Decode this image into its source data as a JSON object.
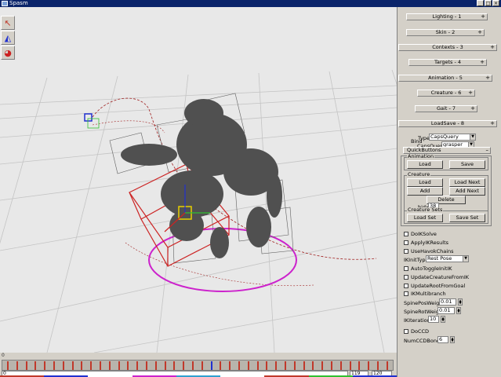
{
  "window": {
    "title": "Spasm",
    "buttons": [
      "_",
      "□",
      "×"
    ]
  },
  "toolbar": {
    "tools": [
      {
        "icon": "select-arrow-icon",
        "glyph": "↖"
      },
      {
        "icon": "ik-effector-icon",
        "glyph": "◭"
      },
      {
        "icon": "physics-icon",
        "glyph": "◕"
      }
    ]
  },
  "rollouts": [
    {
      "label": "Lighting - 1"
    },
    {
      "label": "Skin - 2"
    },
    {
      "label": "Contexts - 3"
    },
    {
      "label": "Targets - 4"
    },
    {
      "label": "Animation - 5"
    },
    {
      "label": "Creature - 6"
    },
    {
      "label": "Gait - 7"
    },
    {
      "label": "LoadSave - 8"
    }
  ],
  "loadsave": {
    "type_label": "Type",
    "type_value": "CapsQuery",
    "caps_label": "CapsQuery",
    "caps_value": "grasper",
    "bind_label": "Bind",
    "quickbuttons_label": "QuickButtons",
    "animation_group": "Animation",
    "load": "Load",
    "save": "Save",
    "creature_group": "Creature",
    "c_load": "Load",
    "c_load_next": "Load Next",
    "c_add": "Add",
    "c_add_next": "Add Next",
    "c_delete": "Delete",
    "bidx_label": "bidx",
    "bidx_value": "38",
    "creature_sets_label": "Creature Sets",
    "load_set": "Load Set",
    "save_set": "Save Set"
  },
  "options": {
    "doiksolve": "DoIKSolve",
    "applyikresults": "ApplyIKResults",
    "usehavokchains": "UseHavokChains",
    "ikinittype_label": "IKInitType",
    "ikinittype_value": "Rest Pose",
    "autotoggleinitik": "AutoToggleInitIK",
    "updatecreaturefromik": "UpdateCreatureFromIK",
    "updaterootfromgoal": "UpdateRootFromGoal",
    "ikmultibranch": "IKMultibranch",
    "spineposweight_label": "SpinePosWeight",
    "spineposweight_value": "0.01",
    "spinerotweight_label": "SpineRotWeight",
    "spinerotweight_value": "0.01",
    "ikiterations_label": "IKIterations",
    "ikiterations_value": "10",
    "doccd": "DoCCD",
    "numccdbones_label": "NumCCDBones",
    "numccdbones_value": "6"
  },
  "timeline": {
    "start_label": "0",
    "current_frame": "0",
    "end_frame": "119",
    "max_frame": "120"
  },
  "colors": {
    "title_bar": "#0a246a",
    "panel_bg": "#d4d0c8",
    "viewport_bg": "#e8e8e8",
    "ik_chain": "#cc2222",
    "ground_ring": "#cc22cc",
    "creature": "#505050"
  }
}
